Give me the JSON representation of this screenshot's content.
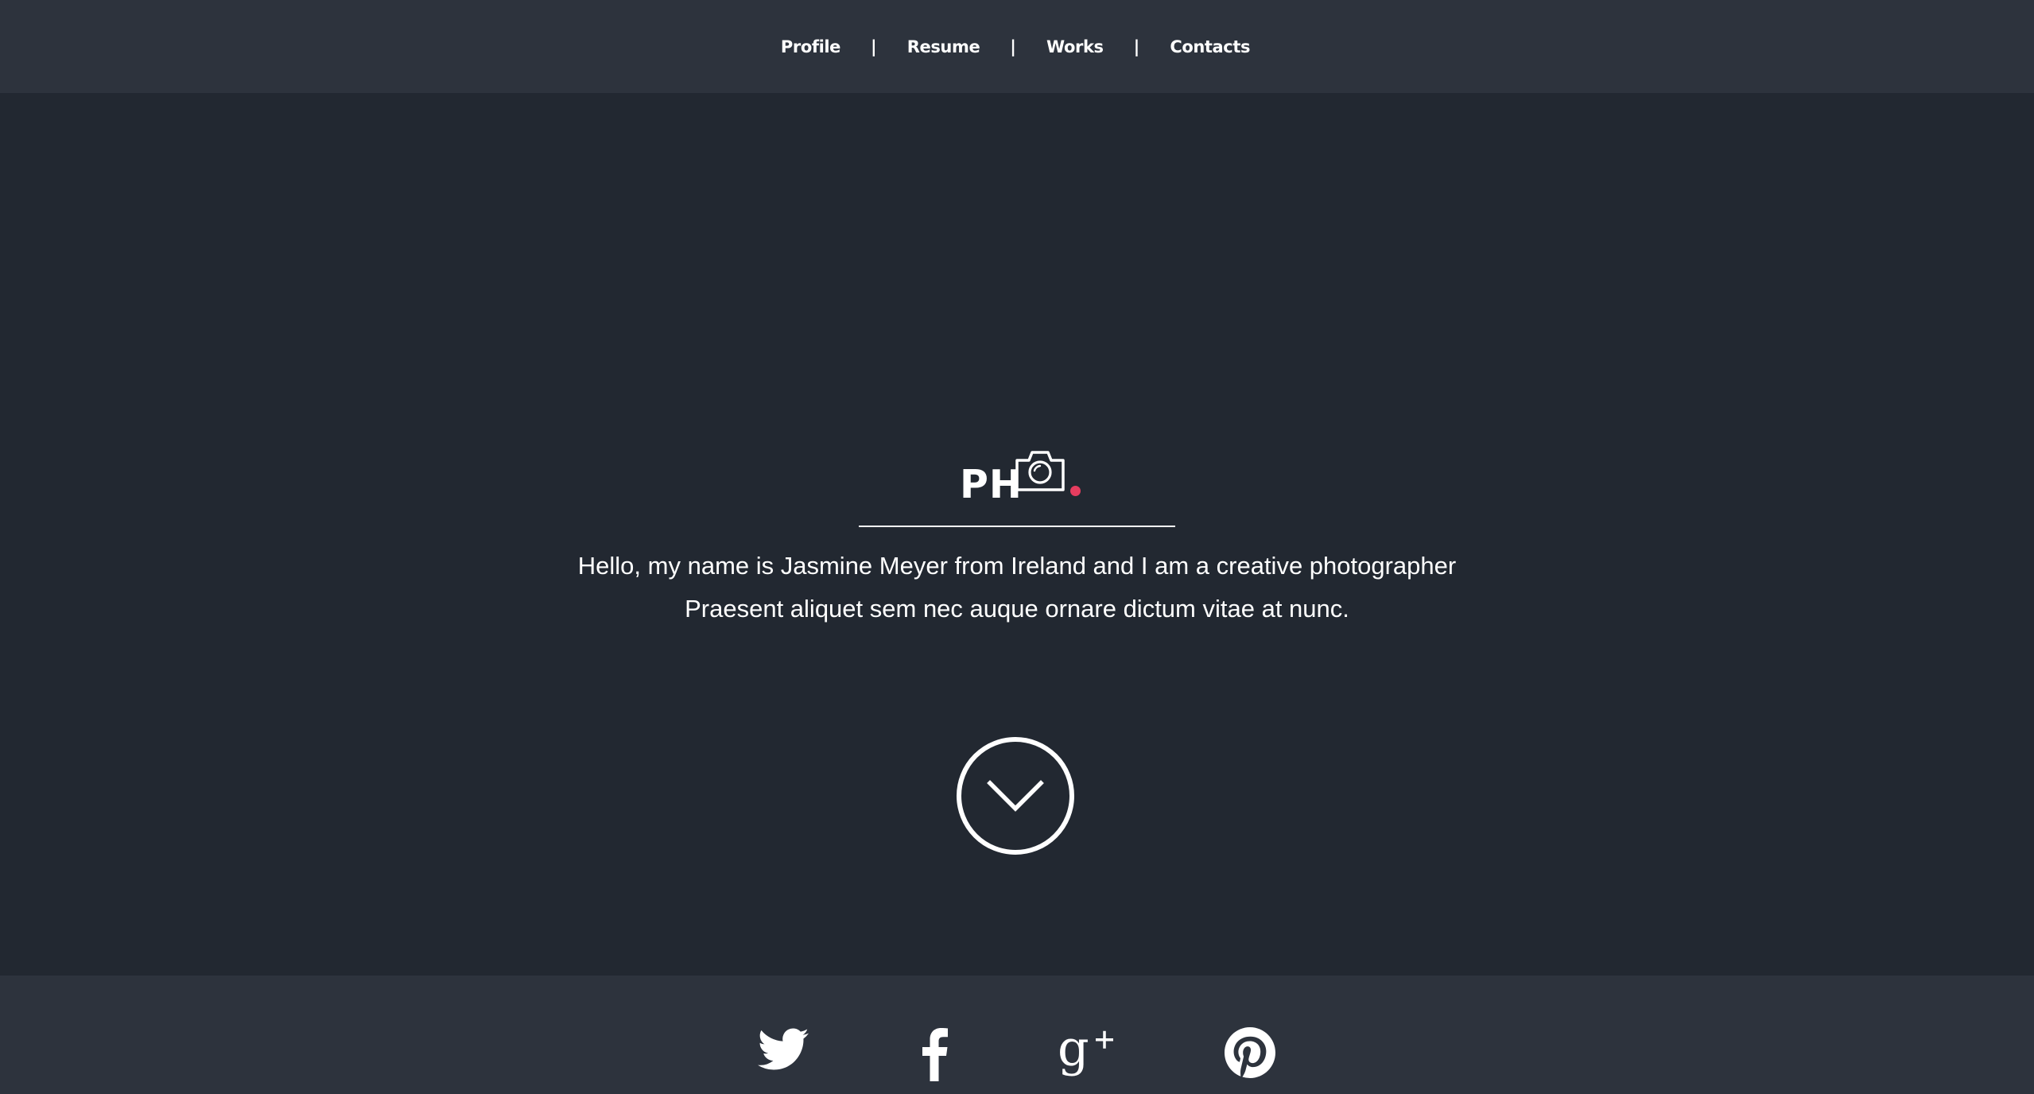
{
  "nav": {
    "items": [
      {
        "label": "Profile"
      },
      {
        "label": "Resume"
      },
      {
        "label": "Works"
      },
      {
        "label": "Contacts"
      }
    ],
    "separator": "|"
  },
  "hero": {
    "logo": {
      "text": "PH",
      "camera_icon": "camera-icon",
      "dot_color": "#e63d5f"
    },
    "intro_line1": "Hello, my name is Jasmine Meyer from Ireland and I am a creative photographer",
    "intro_line2": "Praesent aliquet sem nec auque ornare dictum vitae at nunc.",
    "scroll_icon": "chevron-down-circle-icon"
  },
  "footer": {
    "social": [
      {
        "icon": "twitter-icon"
      },
      {
        "icon": "facebook-icon"
      },
      {
        "icon": "google-plus-icon"
      },
      {
        "icon": "pinterest-icon"
      }
    ]
  },
  "colors": {
    "nav_background": "#2d333d",
    "page_background": "#222831",
    "footer_background": "#2d333d",
    "accent": "#e63d5f",
    "text": "#ffffff"
  }
}
